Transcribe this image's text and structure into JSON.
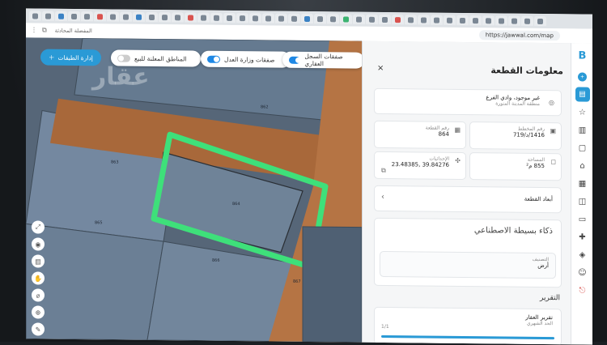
{
  "browser": {
    "url": "https://jawwal.com/map",
    "bookmarks": "المفضلة   المحادثة"
  },
  "map": {
    "manage_button": "إدارة الطبقات",
    "filters": [
      {
        "label": "المناطق المعلنة للبيع",
        "on": false
      },
      {
        "label": "صفقات وزارة العدل",
        "on": true
      },
      {
        "label": "صفقات السجل العقاري",
        "on": true
      }
    ],
    "watermark": "عقار",
    "plot_numbers": [
      "862",
      "864",
      "863",
      "866",
      "865",
      "867"
    ]
  },
  "panel": {
    "title": "معلومات القطعة",
    "close": "×",
    "location": {
      "name": "غير موجود، وادي الفرع",
      "region": "منطقة المدينة المنورة"
    },
    "plan_no": {
      "label": "رقم المخطط",
      "value": "1416/د/719"
    },
    "plot_no": {
      "label": "رقم القطعة",
      "value": "864"
    },
    "area": {
      "label": "المساحة",
      "value": "855 م²"
    },
    "coords": {
      "label": "الإحداثيات",
      "value": "39.84276 ,23.48385"
    },
    "dimensions": "أبعاد القطعة",
    "ai_title": "ذكاء بسيطة الاصطناعي",
    "classification": {
      "label": "التصنيف",
      "value": "أرض"
    },
    "report_title": "التقرير",
    "report": {
      "name": "تقرير العقار",
      "limit": "الحد الشهري",
      "count": "1/1",
      "progress": 1.0
    }
  },
  "sidebar": {
    "logo": "B",
    "badge": "+"
  }
}
